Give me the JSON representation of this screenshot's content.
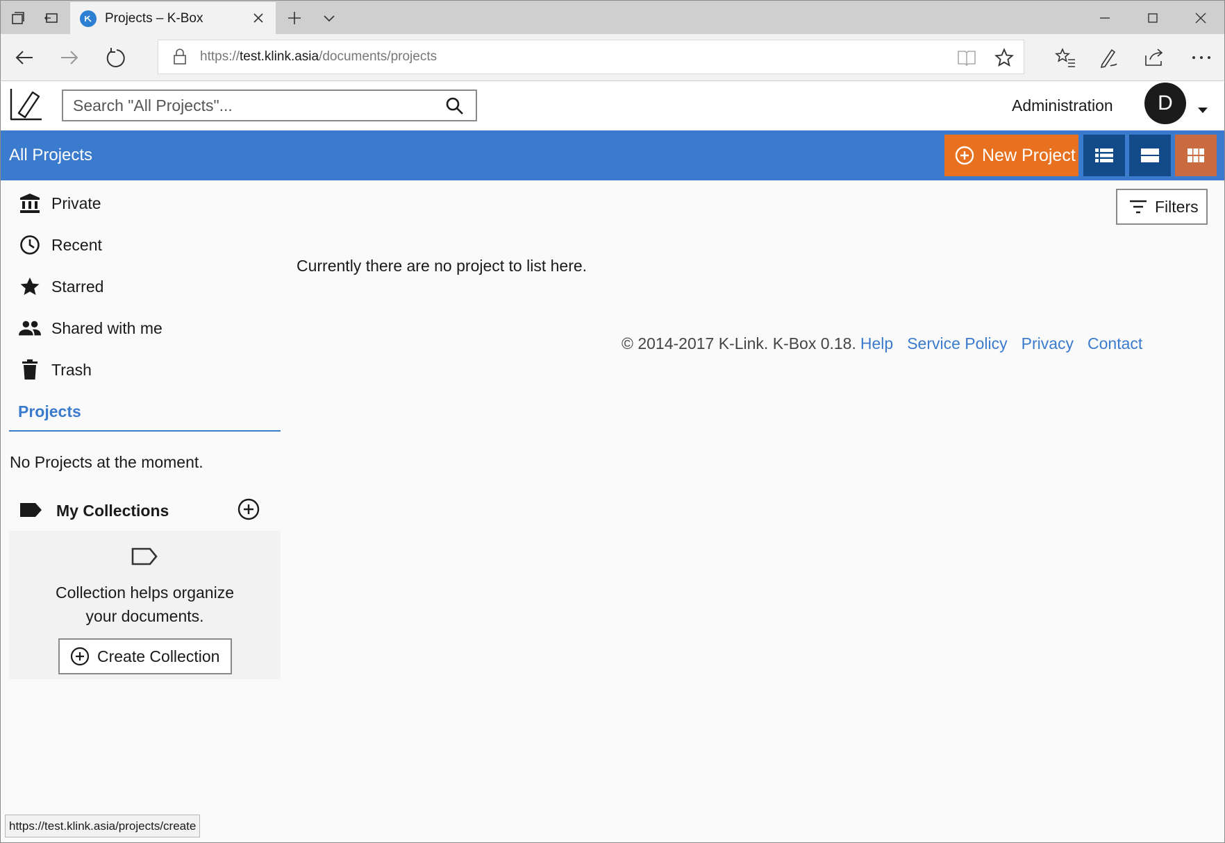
{
  "browser": {
    "tab_title": "Projects – K-Box",
    "url_scheme": "https://",
    "url_host": "test.klink.asia",
    "url_path": "/documents/projects",
    "status_url": "https://test.klink.asia/projects/create"
  },
  "header": {
    "search_placeholder": "Search \"All Projects\"...",
    "admin_label": "Administration",
    "avatar_initial": "D"
  },
  "toolbar": {
    "title": "All Projects",
    "new_project_label": "New Project"
  },
  "sidebar": {
    "items": [
      {
        "label": "Private",
        "icon": "institution-icon"
      },
      {
        "label": "Recent",
        "icon": "clock-icon"
      },
      {
        "label": "Starred",
        "icon": "star-icon"
      },
      {
        "label": "Shared with me",
        "icon": "people-icon"
      },
      {
        "label": "Trash",
        "icon": "trash-icon"
      }
    ],
    "projects_heading": "Projects",
    "no_projects": "No Projects at the moment.",
    "collections_title": "My Collections",
    "collections_msg": "Collection helps organize your documents.",
    "create_collection_label": "Create Collection"
  },
  "main": {
    "filters_label": "Filters",
    "empty_message": "Currently there are no project to list here."
  },
  "footer": {
    "copyright": "© 2014-2017 K-Link. K-Box 0.18.",
    "links": [
      "Help",
      "Service Policy",
      "Privacy",
      "Contact"
    ]
  },
  "colors": {
    "accent_blue": "#3a7bce",
    "new_project_orange": "#e8711f",
    "view_button_dark": "#134a8a",
    "view_button_active": "#c96a40"
  }
}
